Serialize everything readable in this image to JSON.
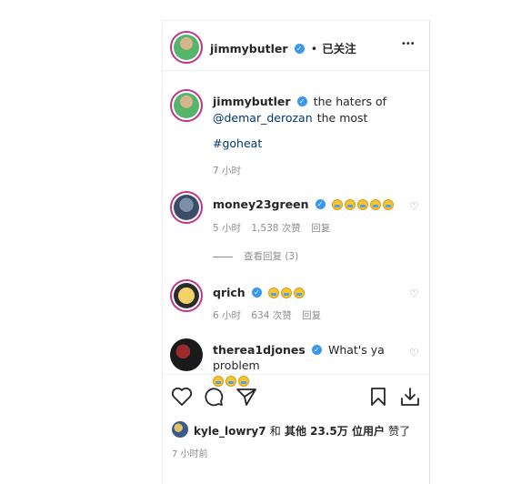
{
  "header": {
    "username": "jimmybutler",
    "separator": "•",
    "follow_status": "已关注",
    "more": "•••"
  },
  "caption": {
    "username": "jimmybutler",
    "text_before": "the haters of",
    "mention": "@demar_derozan",
    "text_after": "the most",
    "hashtag": "#goheat",
    "time": "7 小时"
  },
  "comments": [
    {
      "username": "money23green",
      "emoji_count": 5,
      "time": "5 小时",
      "likes": "1,538 次赞",
      "reply": "回复",
      "view_replies": "查看回复 (3)"
    },
    {
      "username": "qrich",
      "emoji_count": 3,
      "time": "6 小时",
      "likes": "634 次赞",
      "reply": "回复"
    },
    {
      "username": "therea1djones",
      "text": "What's ya problem",
      "emoji_count": 3
    }
  ],
  "actions": {
    "like_icon": "heart-icon",
    "comment_icon": "comment-icon",
    "share_icon": "send-icon",
    "save_icon": "bookmark-icon",
    "download_icon": "download-icon"
  },
  "likes_line": {
    "username": "kyle_lowry7",
    "conj": "和",
    "others": "其他 23.5万 位用户",
    "liked": "赞了"
  },
  "post_time": "7 小时前",
  "colors": {
    "link": "#00376b",
    "verified": "#3897f0",
    "meta": "#8e8e8e"
  }
}
